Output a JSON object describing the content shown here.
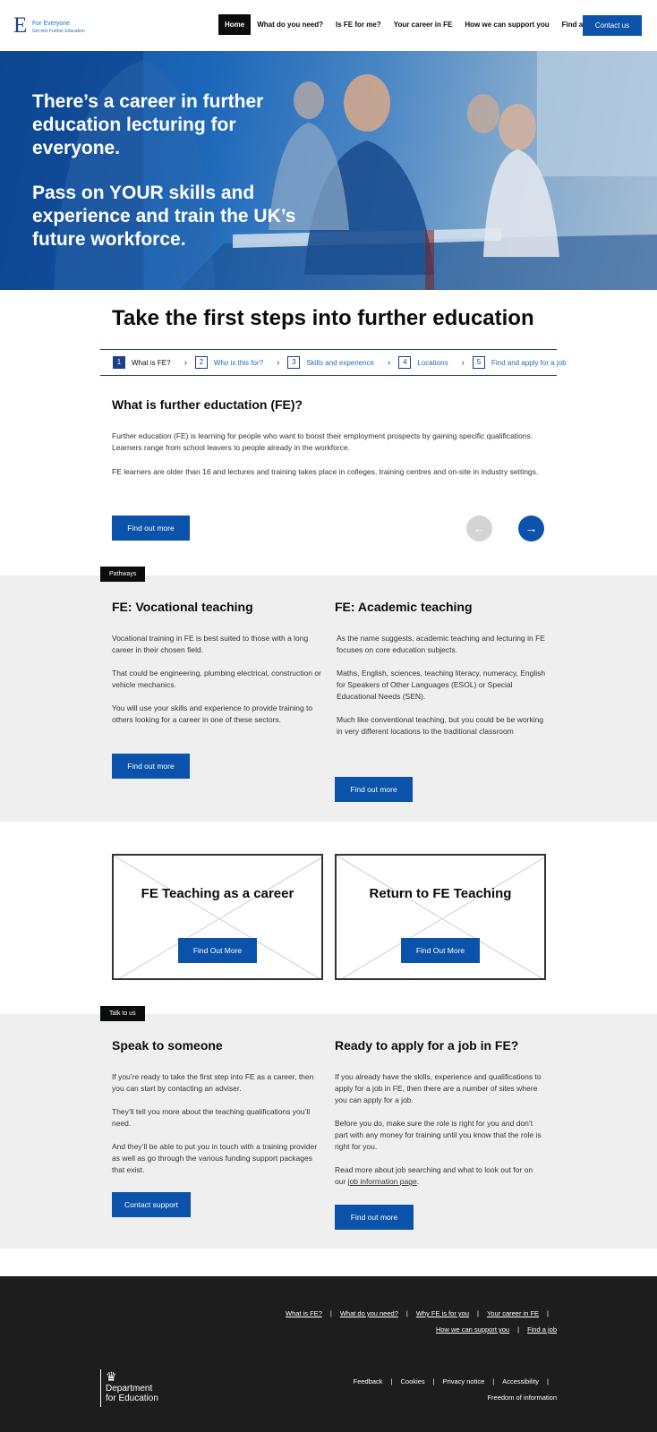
{
  "header": {
    "logo_letter": "E",
    "logo_title": "For Everyone",
    "logo_subtitle": "Get into Further Education",
    "nav": [
      "Home",
      "What do you need?",
      "Is FE for me?",
      "Your career in FE",
      "How we can support you",
      "Find a job"
    ],
    "contact_label": "Contact us"
  },
  "hero": {
    "line1": "There’s a career in further education lecturing  for everyone.",
    "line2": "Pass on YOUR skills and experience and train the UK’s future workforce."
  },
  "steps": {
    "title": "Take the first steps into further education",
    "items": [
      {
        "num": "1",
        "label": "What is FE?"
      },
      {
        "num": "2",
        "label": "Who is this for?"
      },
      {
        "num": "3",
        "label": "Skills and experience"
      },
      {
        "num": "4",
        "label": "Locations"
      },
      {
        "num": "5",
        "label": "Find and apply for a job"
      }
    ],
    "active_step": 1,
    "heading": "What is further eductation (FE)?",
    "para1": "Further education (FE) is learning for people who want to boost their employment prospects by gaining specific qualifications. Learners range from school leavers to people already in the workforce.",
    "para2": "FE learners are older than 16 and lectures and training takes place in colleges, training centres and on-site in industry settings.",
    "button": "Find out more",
    "prev_icon": "arrow-left-icon",
    "next_icon": "arrow-right-icon"
  },
  "pathways": {
    "tag": "Pathways",
    "vocational": {
      "heading": "FE: Vocational teaching",
      "p1": "Vocational training  in FE is best suited to those with a long career in their chosen field.",
      "p2": "That could be engineering, plumbing electrical, construction or vehicle mechanics.",
      "p3": "You will use your skills and experience to provide training to others looking for a  career in one of these sectors.",
      "button": "Find out more"
    },
    "academic": {
      "heading": "FE: Academic teaching",
      "p1": "As the name suggests, academic teaching and lecturing in FE focuses on core education subjects.",
      "p2": "Maths, English, sciences, teaching literacy, numeracy, English for Speakers of Other Languages  (ESOL) or Special Educational Needs (SEN).",
      "p3": "Much like conventional teaching, but you could be be working in very different locations to the traditional classroom",
      "button": "Find out more"
    }
  },
  "cards": [
    {
      "title": "FE Teaching as a career",
      "button": "Find Out More"
    },
    {
      "title": "Return to FE Teaching",
      "button": "Find Out More"
    }
  ],
  "talk": {
    "tag": "Talk to us",
    "speak": {
      "heading": "Speak to someone",
      "p1": "If you’re ready to take the first step into FE as a career, then you can start by contacting an adviser.",
      "p2": "They’ll tell you more about the teaching qualifications you’ll need.",
      "p3": "And they’ll be able to put you in touch with a training provider as well as go through the various funding support packages that exist.",
      "button": "Contact support"
    },
    "apply": {
      "heading": "Ready to apply for a job in FE?",
      "p1": "If you already have the skills, experience and qualifications to apply for a job in FE, then there are a number of sites where you can apply for a job.",
      "p2": "Before you do, make sure the role is right for you and don’t part with any money for training until you know that the role is right for you.",
      "p3_before": "Read more about job searching  and what to look out for on our ",
      "p3_link": "job information page",
      "p3_after": ".",
      "button": "Find out more"
    }
  },
  "footer": {
    "links_row1": [
      "What is FE?",
      "What do you need?",
      "Why FE is for you",
      "Your career in FE"
    ],
    "links_row2": [
      "How we can support you",
      "Find a job"
    ],
    "links_row3": [
      "Feedback",
      "Cookies",
      "Privacy notice",
      "Accessibility"
    ],
    "links_row4": [
      "Freedom of information"
    ],
    "dfe_line1": "Department",
    "dfe_line2": "for Education"
  }
}
